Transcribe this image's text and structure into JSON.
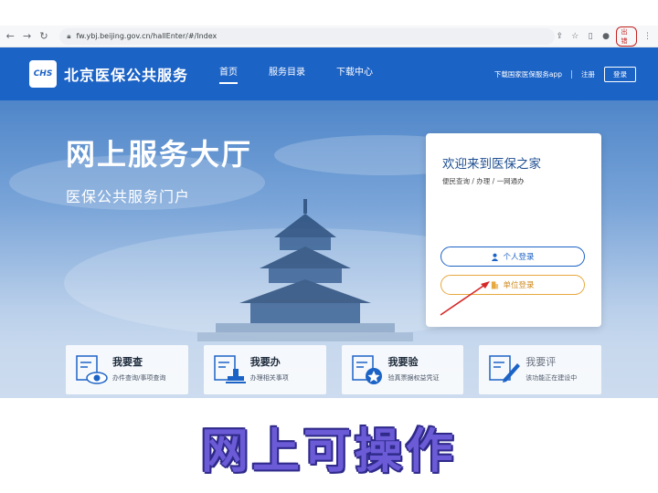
{
  "browser": {
    "url": "fw.ybj.beijing.gov.cn/hallEnter/#/Index",
    "badge": "出错"
  },
  "header": {
    "logo_text": "CHS",
    "site_title": "北京医保公共服务",
    "nav": [
      "首页",
      "服务目录",
      "下载中心"
    ],
    "download_app": "下载国家医保服务app",
    "register": "注册",
    "login": "登录",
    "color": "#1c63c6"
  },
  "hero": {
    "title": "网上服务大厅",
    "subtitle": "医保公共服务门户"
  },
  "login_card": {
    "title": "欢迎来到医保之家",
    "subtitle": "便民查询 / 办理 / 一网通办",
    "personal_login": "个人登录",
    "unit_login": "单位登录"
  },
  "tiles": [
    {
      "title": "我要查",
      "desc": "办件查询/事项查询",
      "icon": "eye-icon"
    },
    {
      "title": "我要办",
      "desc": "办理相关事项",
      "icon": "stamp-icon"
    },
    {
      "title": "我要验",
      "desc": "验真票据权益凭证",
      "icon": "badge-icon"
    },
    {
      "title": "我要评",
      "desc": "该功能正在建设中",
      "icon": "pen-icon"
    }
  ],
  "caption": "网上可操作"
}
